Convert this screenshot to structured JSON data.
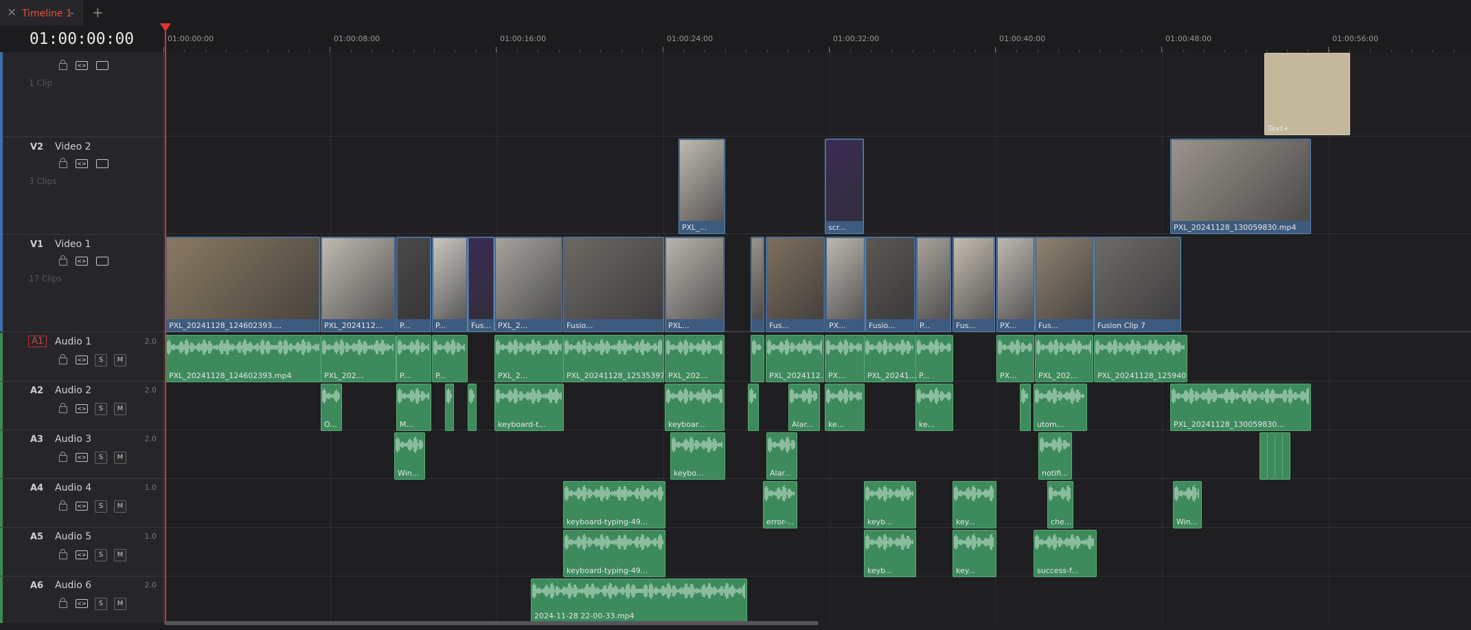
{
  "tab": {
    "close": "×",
    "label": "Timeline 1",
    "chevron": "⌄",
    "add": "+"
  },
  "timecode": "01:00:00:00",
  "ruler": [
    "01:00:00:00",
    "01:00:08:00",
    "01:00:16:00",
    "01:00:24:00",
    "01:00:32:00",
    "01:00:40:00",
    "01:00:48:00",
    "01:00:56:00"
  ],
  "tracks": [
    {
      "id": "",
      "name": "",
      "clips": "1 Clip"
    },
    {
      "id": "V2",
      "name": "Video 2",
      "clips": "3 Clips"
    },
    {
      "id": "V1",
      "name": "Video 1",
      "clips": "17 Clips"
    },
    {
      "id": "A1",
      "name": "Audio 1",
      "ch": "2.0"
    },
    {
      "id": "A2",
      "name": "Audio 2",
      "ch": "2.0"
    },
    {
      "id": "A3",
      "name": "Audio 3",
      "ch": "2.0"
    },
    {
      "id": "A4",
      "name": "Audio 4",
      "ch": "1.0"
    },
    {
      "id": "A5",
      "name": "Audio 5",
      "ch": "1.0"
    },
    {
      "id": "A6",
      "name": "Audio 6",
      "ch": "2.0"
    }
  ],
  "buttons": {
    "solo": "S",
    "mute": "M"
  },
  "v3": [
    {
      "label": "Text+",
      "color": "#c4b89c"
    }
  ],
  "v2": [
    {
      "label": "PXL_..."
    },
    {
      "label": "scr..."
    },
    {
      "label": "PXL_20241128_130059830.mp4"
    }
  ],
  "v1": [
    {
      "label": "PXL_20241128_124602393...."
    },
    {
      "label": "PXL_2024112..."
    },
    {
      "label": "P..."
    },
    {
      "label": "P..."
    },
    {
      "label": "Fus..."
    },
    {
      "label": "PXL_2..."
    },
    {
      "label": "Fusio..."
    },
    {
      "label": "PXL..."
    },
    {
      "label": ""
    },
    {
      "label": "Fus..."
    },
    {
      "label": "PX..."
    },
    {
      "label": "Fusio..."
    },
    {
      "label": "P..."
    },
    {
      "label": "Fus..."
    },
    {
      "label": "PX..."
    },
    {
      "label": "Fus..."
    },
    {
      "label": "Fusion Clip 7"
    }
  ],
  "a1": [
    "PXL_20241128_124602393.mp4",
    "PXL_202...",
    "P...",
    "P...",
    "PXL_2...",
    "PXL_20241128_12535397...",
    "PXL_202...",
    "",
    "PXL_2024112...",
    "PX...",
    "PXL_20241...",
    "P...",
    "PX...",
    "PXL_202...",
    "PXL_20241128_125940..."
  ],
  "a2": [
    "O...",
    "M...",
    "",
    "",
    "keyboard-t...",
    "keyboar...",
    "",
    "Alar...",
    "ke...",
    "ke...",
    "",
    "utom...",
    "PXL_20241128_130059830..."
  ],
  "a3": [
    "Win...",
    "keybo...",
    "Alar...",
    "notifi..."
  ],
  "a4": [
    "keyboard-typing-49...",
    "error-...",
    "keyb...",
    "key...",
    "che...",
    "Win..."
  ],
  "a5": [
    "keyboard-typing-49...",
    "keyb...",
    "key...",
    "success-f..."
  ],
  "a6": [
    "2024-11-28 22-00-33.mp4"
  ]
}
